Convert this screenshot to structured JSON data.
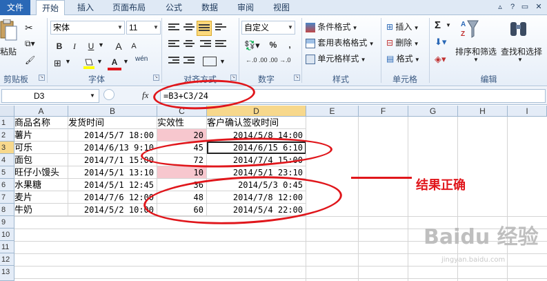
{
  "tabs": {
    "file": "文件",
    "home": "开始",
    "insert": "插入",
    "page_layout": "页面布局",
    "formulas": "公式",
    "data": "数据",
    "review": "审阅",
    "view": "视图"
  },
  "ribbon": {
    "clipboard": {
      "paste": "粘贴",
      "label": "剪贴板"
    },
    "font": {
      "name": "宋体",
      "size": "11",
      "bold": "B",
      "italic": "I",
      "underline": "U",
      "grow": "A",
      "shrink": "A",
      "font_color": "A",
      "phonetic": "wén",
      "label": "字体"
    },
    "alignment": {
      "label": "对齐方式"
    },
    "number": {
      "format": "自定义",
      "percent": "%",
      "comma": ",",
      "label": "数字"
    },
    "styles": {
      "conditional": "条件格式",
      "table": "套用表格格式",
      "cell_styles": "单元格样式",
      "label": "样式"
    },
    "cells": {
      "insert": "插入",
      "delete": "删除",
      "format": "格式",
      "label": "单元格"
    },
    "editing": {
      "sigma": "Σ",
      "sort": "排序和筛选",
      "find": "查找和选择",
      "label": "编辑"
    }
  },
  "formula_bar": {
    "name_box": "D3",
    "fx": "fx",
    "formula": "=B3+C3/24"
  },
  "columns": [
    "A",
    "B",
    "C",
    "D",
    "E",
    "F",
    "G",
    "H",
    "I"
  ],
  "rows": [
    "1",
    "2",
    "3",
    "4",
    "5",
    "6",
    "7",
    "8",
    "9",
    "10",
    "11",
    "12",
    "13"
  ],
  "table": {
    "headers": [
      "商品名称",
      "发货时间",
      "实效性",
      "客户确认签收时间"
    ],
    "data": [
      [
        "薯片",
        "2014/5/7 18:00",
        "20",
        "2014/5/8 14:00"
      ],
      [
        "可乐",
        "2014/6/13 9:10",
        "45",
        "2014/6/15 6:10"
      ],
      [
        "面包",
        "2014/7/1 15:00",
        "72",
        "2014/7/4 15:00"
      ],
      [
        "旺仔小馒头",
        "2014/5/1 13:10",
        "10",
        "2014/5/1 23:10"
      ],
      [
        "水果糖",
        "2014/5/1 12:45",
        "36",
        "2014/5/3 0:45"
      ],
      [
        "麦片",
        "2014/7/6 12:00",
        "48",
        "2014/7/8 12:00"
      ],
      [
        "牛奶",
        "2014/5/2 10:00",
        "60",
        "2014/5/4 22:00"
      ]
    ]
  },
  "annotation": {
    "result_text": "结果正确",
    "color": "#e0161b"
  },
  "watermark": {
    "brand": "Baidu 经验",
    "url": "jingyan.baidu.com"
  },
  "colors": {
    "tab_file": "#2a68b6",
    "ribbon_bg": "#e6eef8",
    "highlight": "#f7c7ce"
  }
}
